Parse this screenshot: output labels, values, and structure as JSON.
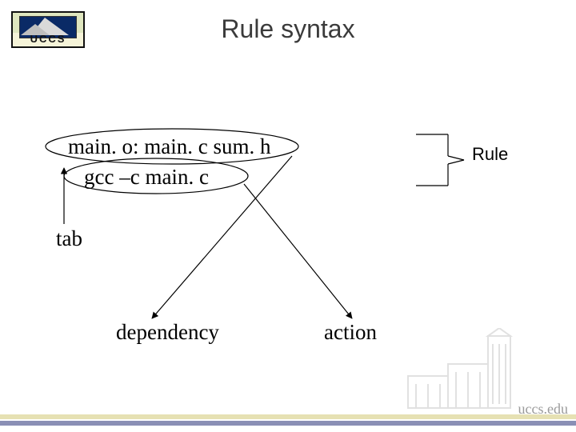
{
  "title": "Rule syntax",
  "logo_text": "UCCS",
  "rule": {
    "dependency_line": "main. o: main. c sum. h",
    "action_line": "gcc –c main. c"
  },
  "labels": {
    "rule": "Rule",
    "tab": "tab",
    "dependency": "dependency",
    "action": "action"
  },
  "footer_brand": "uccs.edu"
}
